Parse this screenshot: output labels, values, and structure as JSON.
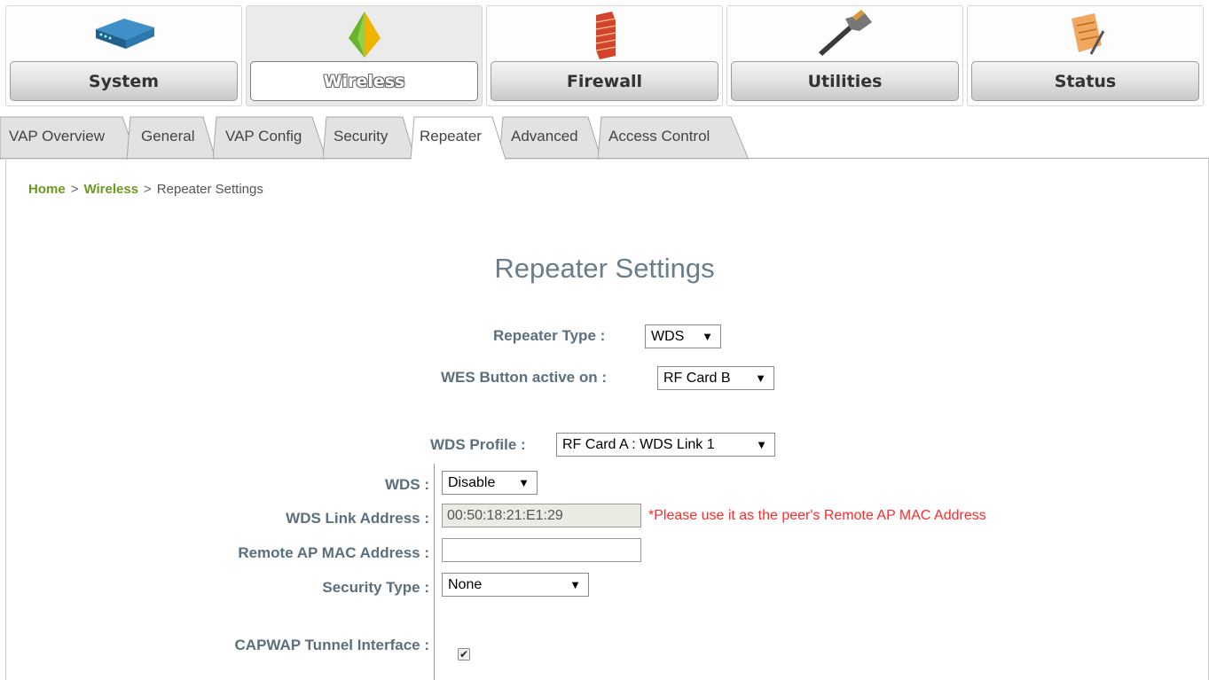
{
  "nav": {
    "items": [
      {
        "label": "System",
        "icon": "network-device-icon"
      },
      {
        "label": "Wireless",
        "icon": "wireless-pyramid-icon"
      },
      {
        "label": "Firewall",
        "icon": "brick-wall-icon"
      },
      {
        "label": "Utilities",
        "icon": "hammer-icon"
      },
      {
        "label": "Status",
        "icon": "notepad-icon"
      }
    ],
    "active": "Wireless"
  },
  "tabs": {
    "items": [
      "VAP Overview",
      "General",
      "VAP Config",
      "Security",
      "Repeater",
      "Advanced",
      "Access Control"
    ],
    "active": "Repeater"
  },
  "breadcrumb": {
    "home": "Home",
    "section": "Wireless",
    "separator": ">",
    "current": "Repeater Settings"
  },
  "page": {
    "title": "Repeater Settings"
  },
  "form": {
    "repeater_type": {
      "label": "Repeater Type :",
      "value": "WDS"
    },
    "wes_button": {
      "label": "WES Button active on :",
      "value": "RF Card B"
    },
    "wds_profile": {
      "label": "WDS Profile :",
      "value": "RF Card A : WDS Link 1"
    },
    "wds": {
      "label": "WDS :",
      "value": "Disable"
    },
    "wds_link_address": {
      "label": "WDS Link Address :",
      "value": "00:50:18:21:E1:29",
      "note": "*Please use it as the peer's Remote AP MAC Address"
    },
    "remote_ap_mac": {
      "label": "Remote AP MAC Address :",
      "value": ""
    },
    "security_type": {
      "label": "Security Type :",
      "value": "None"
    },
    "capwap": {
      "label": "CAPWAP Tunnel Interface :",
      "checked": true,
      "check_glyph": "✔"
    },
    "dropdown_arrow": "▼"
  },
  "colors": {
    "accent_green": "#6a9a1f",
    "label": "#5b6f7d",
    "note_red": "#ff2a2a",
    "title": "#6a7d8b"
  }
}
